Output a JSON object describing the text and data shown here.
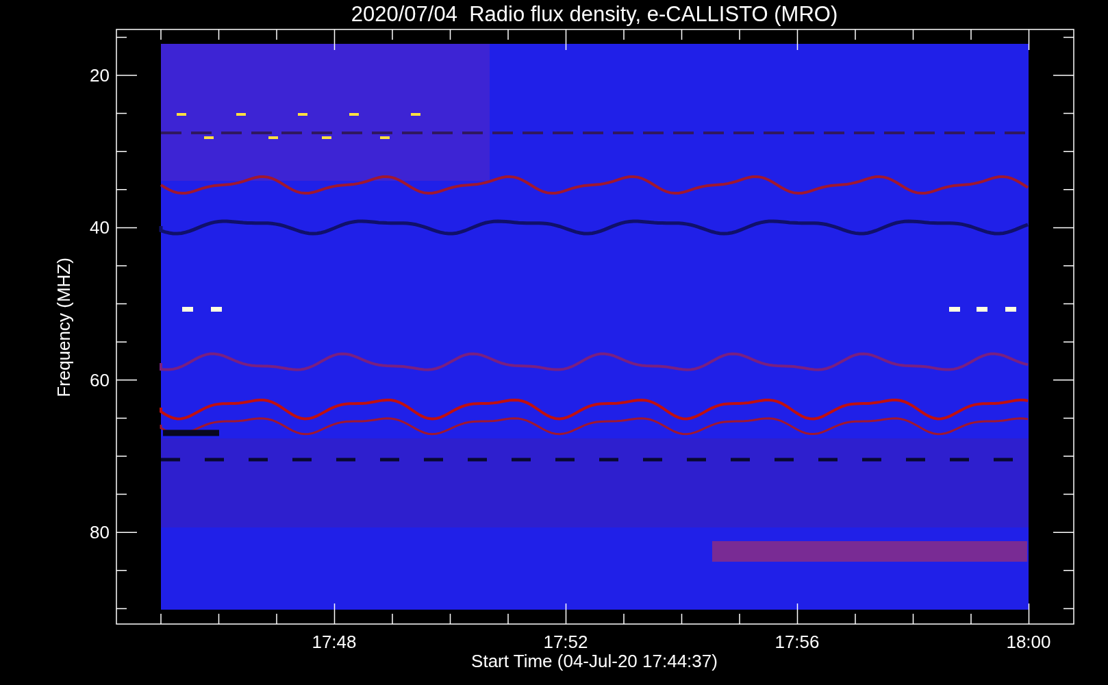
{
  "title": "2020/07/04  Radio flux density, e-CALLISTO (MRO)",
  "y_axis": {
    "label": "Frequency (MHZ)",
    "ticks": [
      "20",
      "40",
      "60",
      "80"
    ]
  },
  "x_axis": {
    "label": "Start Time (04-Jul-20 17:44:37)",
    "ticks": [
      "17:48",
      "17:52",
      "17:56",
      "18:00"
    ]
  }
}
